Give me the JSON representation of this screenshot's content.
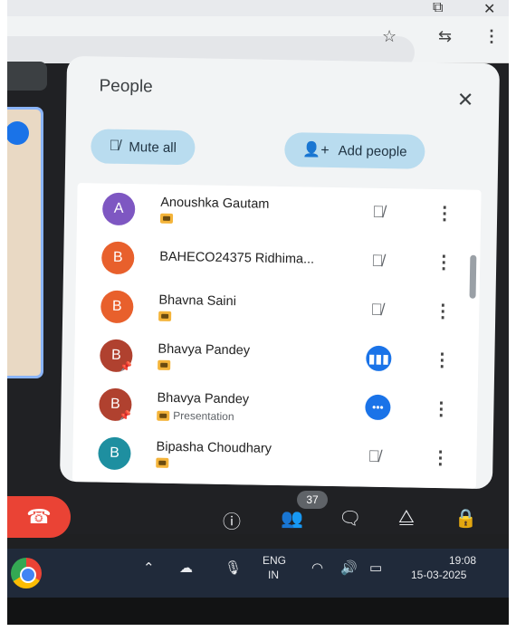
{
  "browser": {
    "restore_icon": "restore-window-icon",
    "close_icon": "close-window-icon",
    "bookmark_icon": "star-icon",
    "extensions_icon": "profile-sync-icon",
    "menu_icon": "kebab-menu-icon"
  },
  "people_panel": {
    "title": "People",
    "mute_all_label": "Mute all",
    "add_people_label": "Add people",
    "participants": [
      {
        "initial": "A",
        "name": "Anoushka Gautam",
        "subtitle": "",
        "avatar_color": "#7e57c2",
        "status": "muted"
      },
      {
        "initial": "B",
        "name": "BAHECO24375 Ridhima...",
        "subtitle": "",
        "avatar_color": "#e8602c",
        "status": "muted"
      },
      {
        "initial": "B",
        "name": "Bhavna Saini",
        "subtitle": "",
        "avatar_color": "#e8602c",
        "status": "muted"
      },
      {
        "initial": "B",
        "name": "Bhavya Pandey",
        "subtitle": "",
        "avatar_color": "#b0412f",
        "status": "speaking"
      },
      {
        "initial": "B",
        "name": "Bhavya Pandey",
        "subtitle": "Presentation",
        "avatar_color": "#b0412f",
        "status": "presenting"
      },
      {
        "initial": "B",
        "name": "Bipasha Choudhary",
        "subtitle": "",
        "avatar_color": "#1e8fa0",
        "status": "muted"
      }
    ]
  },
  "meet_controls": {
    "participant_count": "37"
  },
  "taskbar": {
    "language": "ENG",
    "region": "IN",
    "time": "19:08",
    "date": "15-03-2025"
  }
}
